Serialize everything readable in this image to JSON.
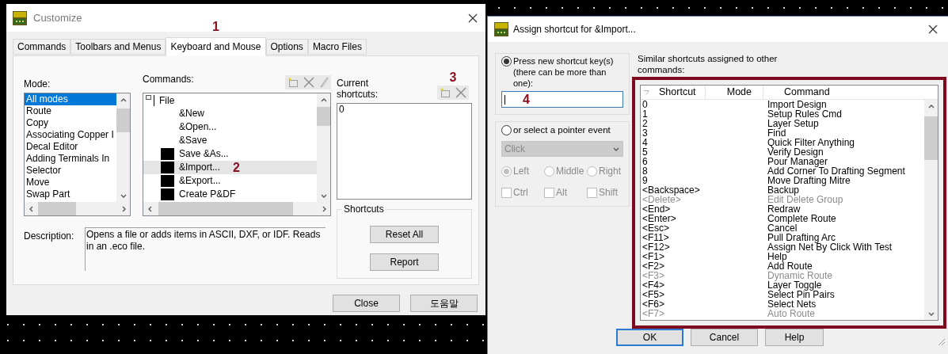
{
  "customize": {
    "title": "Customize",
    "tabs": [
      {
        "label": "Commands",
        "selected": false
      },
      {
        "label": "Toolbars and Menus",
        "selected": false
      },
      {
        "label": "Keyboard and Mouse",
        "selected": true
      },
      {
        "label": "Options",
        "selected": false
      },
      {
        "label": "Macro Files",
        "selected": false
      }
    ],
    "tab_marker": "1",
    "mode": {
      "label": "Mode:",
      "items": [
        {
          "label": "All modes",
          "selected": true
        },
        {
          "label": "Route",
          "selected": false
        },
        {
          "label": "Copy",
          "selected": false
        },
        {
          "label": "Associating Copper I",
          "selected": false
        },
        {
          "label": "Decal Editor",
          "selected": false
        },
        {
          "label": "Adding Terminals In",
          "selected": false
        },
        {
          "label": "Selector",
          "selected": false
        },
        {
          "label": "Move",
          "selected": false
        },
        {
          "label": "Swap Part",
          "selected": false
        }
      ]
    },
    "commands": {
      "label": "Commands:",
      "marker": "2",
      "items": [
        {
          "label": "File",
          "kind": "folder",
          "selected": false,
          "children": [
            {
              "label": "&New",
              "kind": "command",
              "has_icon": false,
              "selected": false
            },
            {
              "label": "&Open...",
              "kind": "command",
              "has_icon": false,
              "selected": false
            },
            {
              "label": "&Save",
              "kind": "command",
              "has_icon": false,
              "selected": false
            },
            {
              "label": "Save &As...",
              "kind": "command",
              "has_icon": true,
              "selected": false
            },
            {
              "label": "&Import...",
              "kind": "command",
              "has_icon": true,
              "selected": true
            },
            {
              "label": "&Export...",
              "kind": "command",
              "has_icon": true,
              "selected": false
            },
            {
              "label": "Create P&DF",
              "kind": "command",
              "has_icon": true,
              "selected": false
            }
          ]
        }
      ]
    },
    "current_shortcuts": {
      "label": "Current shortcuts:",
      "marker": "3",
      "items": [
        "0"
      ]
    },
    "shortcuts_group": {
      "title": "Shortcuts",
      "buttons": [
        "Reset All",
        "Report"
      ]
    },
    "description": {
      "label": "Description:",
      "text": "Opens a file or adds items in ASCII, DXF, or IDF. Reads in an .eco file."
    },
    "buttons": [
      "Close",
      "도움말"
    ]
  },
  "assign": {
    "title": "Assign shortcut for &Import...",
    "key_option": {
      "label": "Press new shortcut key(s) (there can be more than one):",
      "selected": true
    },
    "shortcut_input": {
      "marker": "4"
    },
    "pointer_option": {
      "label": "or select a pointer event",
      "selected": false
    },
    "pointer_event": {
      "value": "Click",
      "disabled": true
    },
    "buttons_radio": [
      {
        "label": "Left",
        "selected": true,
        "disabled": true
      },
      {
        "label": "Middle",
        "selected": false,
        "disabled": true
      },
      {
        "label": "Right",
        "selected": false,
        "disabled": true
      }
    ],
    "modifiers": [
      {
        "label": "Ctrl",
        "checked": false,
        "disabled": true
      },
      {
        "label": "Alt",
        "checked": false,
        "disabled": true
      },
      {
        "label": "Shift",
        "checked": false,
        "disabled": true
      }
    ],
    "similar": {
      "label": "Similar shortcuts assigned to other commands:",
      "columns": [
        "Shortcut",
        "Mode",
        "Command"
      ],
      "rows": [
        {
          "shortcut": "0",
          "command": "Import Design",
          "disabled": false
        },
        {
          "shortcut": "1",
          "command": "Setup Rules Cmd",
          "disabled": false
        },
        {
          "shortcut": "2",
          "command": "Layer Setup",
          "disabled": false
        },
        {
          "shortcut": "3",
          "command": "Find",
          "disabled": false
        },
        {
          "shortcut": "4",
          "command": "Quick Filter Anything",
          "disabled": false
        },
        {
          "shortcut": "5",
          "command": "Verify Design",
          "disabled": false
        },
        {
          "shortcut": "6",
          "command": "Pour Manager",
          "disabled": false
        },
        {
          "shortcut": "8",
          "command": "Add Corner To Drafting Segment",
          "disabled": false
        },
        {
          "shortcut": "9",
          "command": "Move Drafting Mitre",
          "disabled": false
        },
        {
          "shortcut": "<Backspace>",
          "command": "Backup",
          "disabled": false
        },
        {
          "shortcut": "<Delete>",
          "command": "Edit Delete Group",
          "disabled": true
        },
        {
          "shortcut": "<End>",
          "command": "Redraw",
          "disabled": false
        },
        {
          "shortcut": "<Enter>",
          "command": "Complete Route",
          "disabled": false
        },
        {
          "shortcut": "<Esc>",
          "command": "Cancel",
          "disabled": false
        },
        {
          "shortcut": "<F11>",
          "command": "Pull Drafting Arc",
          "disabled": false
        },
        {
          "shortcut": "<F12>",
          "command": "Assign Net By Click With Test",
          "disabled": false
        },
        {
          "shortcut": "<F1>",
          "command": "Help",
          "disabled": false
        },
        {
          "shortcut": "<F2>",
          "command": "Add Route",
          "disabled": false
        },
        {
          "shortcut": "<F3>",
          "command": "Dynamic Route",
          "disabled": true
        },
        {
          "shortcut": "<F4>",
          "command": "Layer Toggle",
          "disabled": false
        },
        {
          "shortcut": "<F5>",
          "command": "Select Pin Pairs",
          "disabled": false
        },
        {
          "shortcut": "<F6>",
          "command": "Select Nets",
          "disabled": false
        },
        {
          "shortcut": "<F7>",
          "command": "Auto Route",
          "disabled": true
        }
      ]
    },
    "buttons": [
      {
        "label": "OK",
        "default": true
      },
      {
        "label": "Cancel",
        "default": false
      },
      {
        "label": "Help",
        "default": false
      }
    ]
  }
}
